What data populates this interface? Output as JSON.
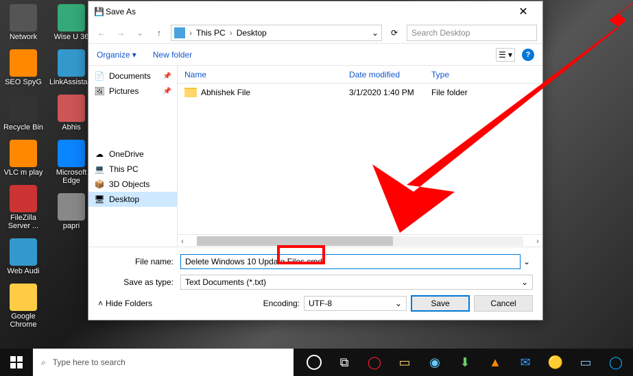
{
  "desktop_icons": [
    "Network",
    "SEO SpyG",
    "Recycle Bin",
    "VLC m play",
    "FileZilla Server ...",
    "Web Audi",
    "Google Chrome",
    "Wise U 36",
    "LinkAssistant",
    "Abhis",
    "Microsoft Edge",
    "papri"
  ],
  "dialog": {
    "title": "Save As",
    "breadcrumb": {
      "root": "This PC",
      "folder": "Desktop"
    },
    "search_placeholder": "Search Desktop",
    "toolbar": {
      "organize": "Organize",
      "new_folder": "New folder"
    },
    "tree": {
      "top": [
        {
          "label": "Documents",
          "icon": "📄",
          "pinned": true
        },
        {
          "label": "Pictures",
          "icon": "🖼",
          "pinned": true
        }
      ],
      "bottom": [
        {
          "label": "OneDrive",
          "icon": "☁"
        },
        {
          "label": "This PC",
          "icon": "💻"
        },
        {
          "label": "3D Objects",
          "icon": "📦"
        },
        {
          "label": "Desktop",
          "icon": "🖥",
          "selected": true
        }
      ]
    },
    "columns": {
      "name": "Name",
      "date": "Date modified",
      "type": "Type"
    },
    "rows": [
      {
        "name": "Abhishek File",
        "date": "3/1/2020 1:40 PM",
        "type": "File folder"
      }
    ],
    "form": {
      "filename_label": "File name:",
      "filename_value": "Delete Windows 10 Update Files.cmd",
      "type_label": "Save as type:",
      "type_value": "Text Documents (*.txt)",
      "hide_folders": "Hide Folders",
      "encoding_label": "Encoding:",
      "encoding_value": "UTF-8",
      "save": "Save",
      "cancel": "Cancel"
    }
  },
  "taskbar": {
    "search_placeholder": "Type here to search"
  }
}
